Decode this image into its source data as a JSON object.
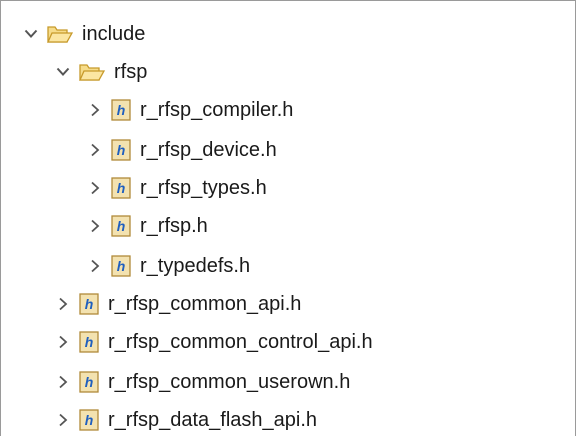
{
  "tree": {
    "include": {
      "label": "include",
      "expanded": true,
      "icon": "folder-open-icon"
    },
    "rfsp": {
      "label": "rfsp",
      "expanded": true,
      "icon": "folder-open-icon"
    },
    "rfsp_files": [
      {
        "label": "r_rfsp_compiler.h",
        "icon": "header-file-icon"
      },
      {
        "label": "r_rfsp_device.h",
        "icon": "header-file-icon"
      },
      {
        "label": "r_rfsp_types.h",
        "icon": "header-file-icon"
      },
      {
        "label": "r_rfsp.h",
        "icon": "header-file-icon"
      },
      {
        "label": "r_typedefs.h",
        "icon": "header-file-icon"
      }
    ],
    "include_files": [
      {
        "label": "r_rfsp_common_api.h",
        "icon": "header-file-icon"
      },
      {
        "label": "r_rfsp_common_control_api.h",
        "icon": "header-file-icon"
      },
      {
        "label": "r_rfsp_common_userown.h",
        "icon": "header-file-icon"
      },
      {
        "label": "r_rfsp_data_flash_api.h",
        "icon": "header-file-icon"
      }
    ]
  },
  "colors": {
    "folder_fill": "#f6dc8a",
    "folder_stroke": "#c79a2b",
    "file_fill": "#f3e2b0",
    "file_stroke": "#b08a3a",
    "file_letter": "#1f5fbf",
    "chevron": "#555555"
  }
}
